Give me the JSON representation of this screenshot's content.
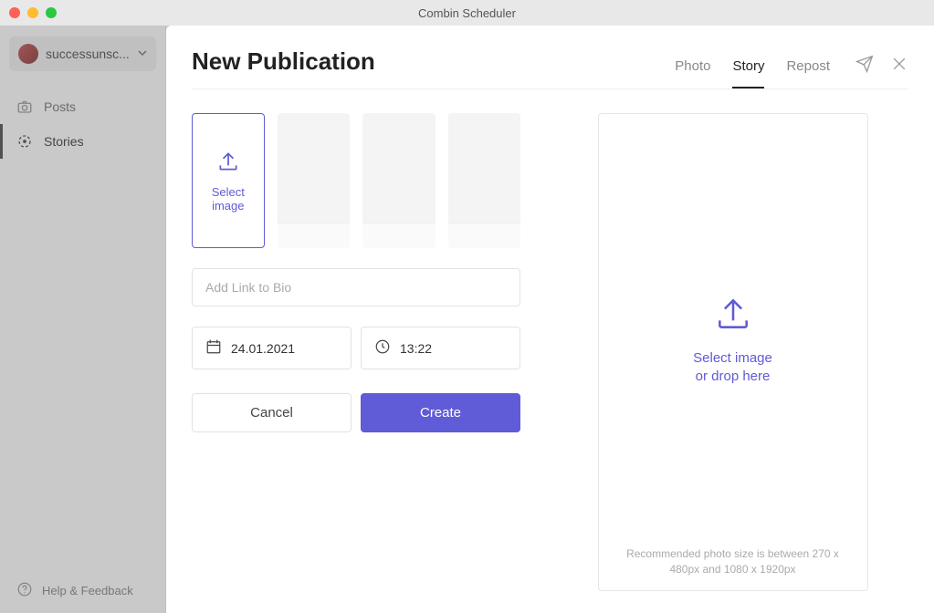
{
  "window": {
    "title": "Combin Scheduler"
  },
  "sidebar": {
    "account_name": "successunsc...",
    "items": [
      {
        "label": "Posts"
      },
      {
        "label": "Stories"
      }
    ],
    "footer": "Help & Feedback"
  },
  "panel": {
    "title": "New Publication",
    "tabs": [
      {
        "label": "Photo"
      },
      {
        "label": "Story"
      },
      {
        "label": "Repost"
      }
    ],
    "slot_primary_line1": "Select",
    "slot_primary_line2": "image",
    "link_placeholder": "Add Link to Bio",
    "date_value": "24.01.2021",
    "time_value": "13:22",
    "cancel_label": "Cancel",
    "create_label": "Create",
    "preview_line1": "Select image",
    "preview_line2": "or drop here",
    "preview_note": "Recommended photo size is between 270 x 480px and 1080 x 1920px"
  }
}
